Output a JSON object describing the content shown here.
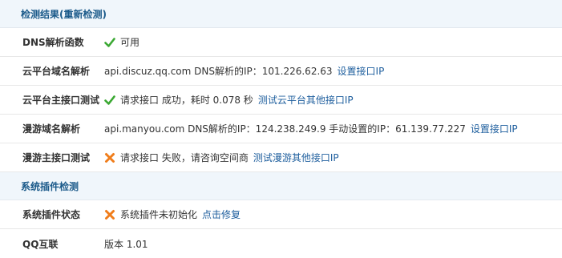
{
  "sections": {
    "check": {
      "title": "检测结果(重新检测)"
    },
    "plugin": {
      "title": "系统插件检测"
    }
  },
  "rows": {
    "dns": {
      "label": "DNS解析函数",
      "status": "可用",
      "icon": "check-icon"
    },
    "cloud_domain": {
      "label": "云平台域名解析",
      "text": "api.discuz.qq.com DNS解析的IP：101.226.62.63",
      "link": "设置接口IP"
    },
    "cloud_api": {
      "label": "云平台主接口测试",
      "icon": "check-icon",
      "text": "请求接口 成功，耗时 0.078 秒",
      "link": "测试云平台其他接口IP"
    },
    "manyou_domain": {
      "label": "漫游域名解析",
      "text": "api.manyou.com DNS解析的IP：124.238.249.9 手动设置的IP：61.139.77.227",
      "link": "设置接口IP"
    },
    "manyou_api": {
      "label": "漫游主接口测试",
      "icon": "cross-icon",
      "text": "请求接口 失败，请咨询空间商",
      "link": "测试漫游其他接口IP"
    },
    "plugin_status": {
      "label": "系统插件状态",
      "icon": "cross-icon",
      "text": "系统插件未初始化",
      "link": "点击修复"
    },
    "qq": {
      "label": "QQ互联",
      "text": "版本 1.01"
    }
  },
  "colors": {
    "header_bg": "#f0f6fb",
    "header_text": "#1b5a8a",
    "link": "#1f5f9e",
    "check": "#3aa832",
    "cross": "#f07d1b"
  }
}
